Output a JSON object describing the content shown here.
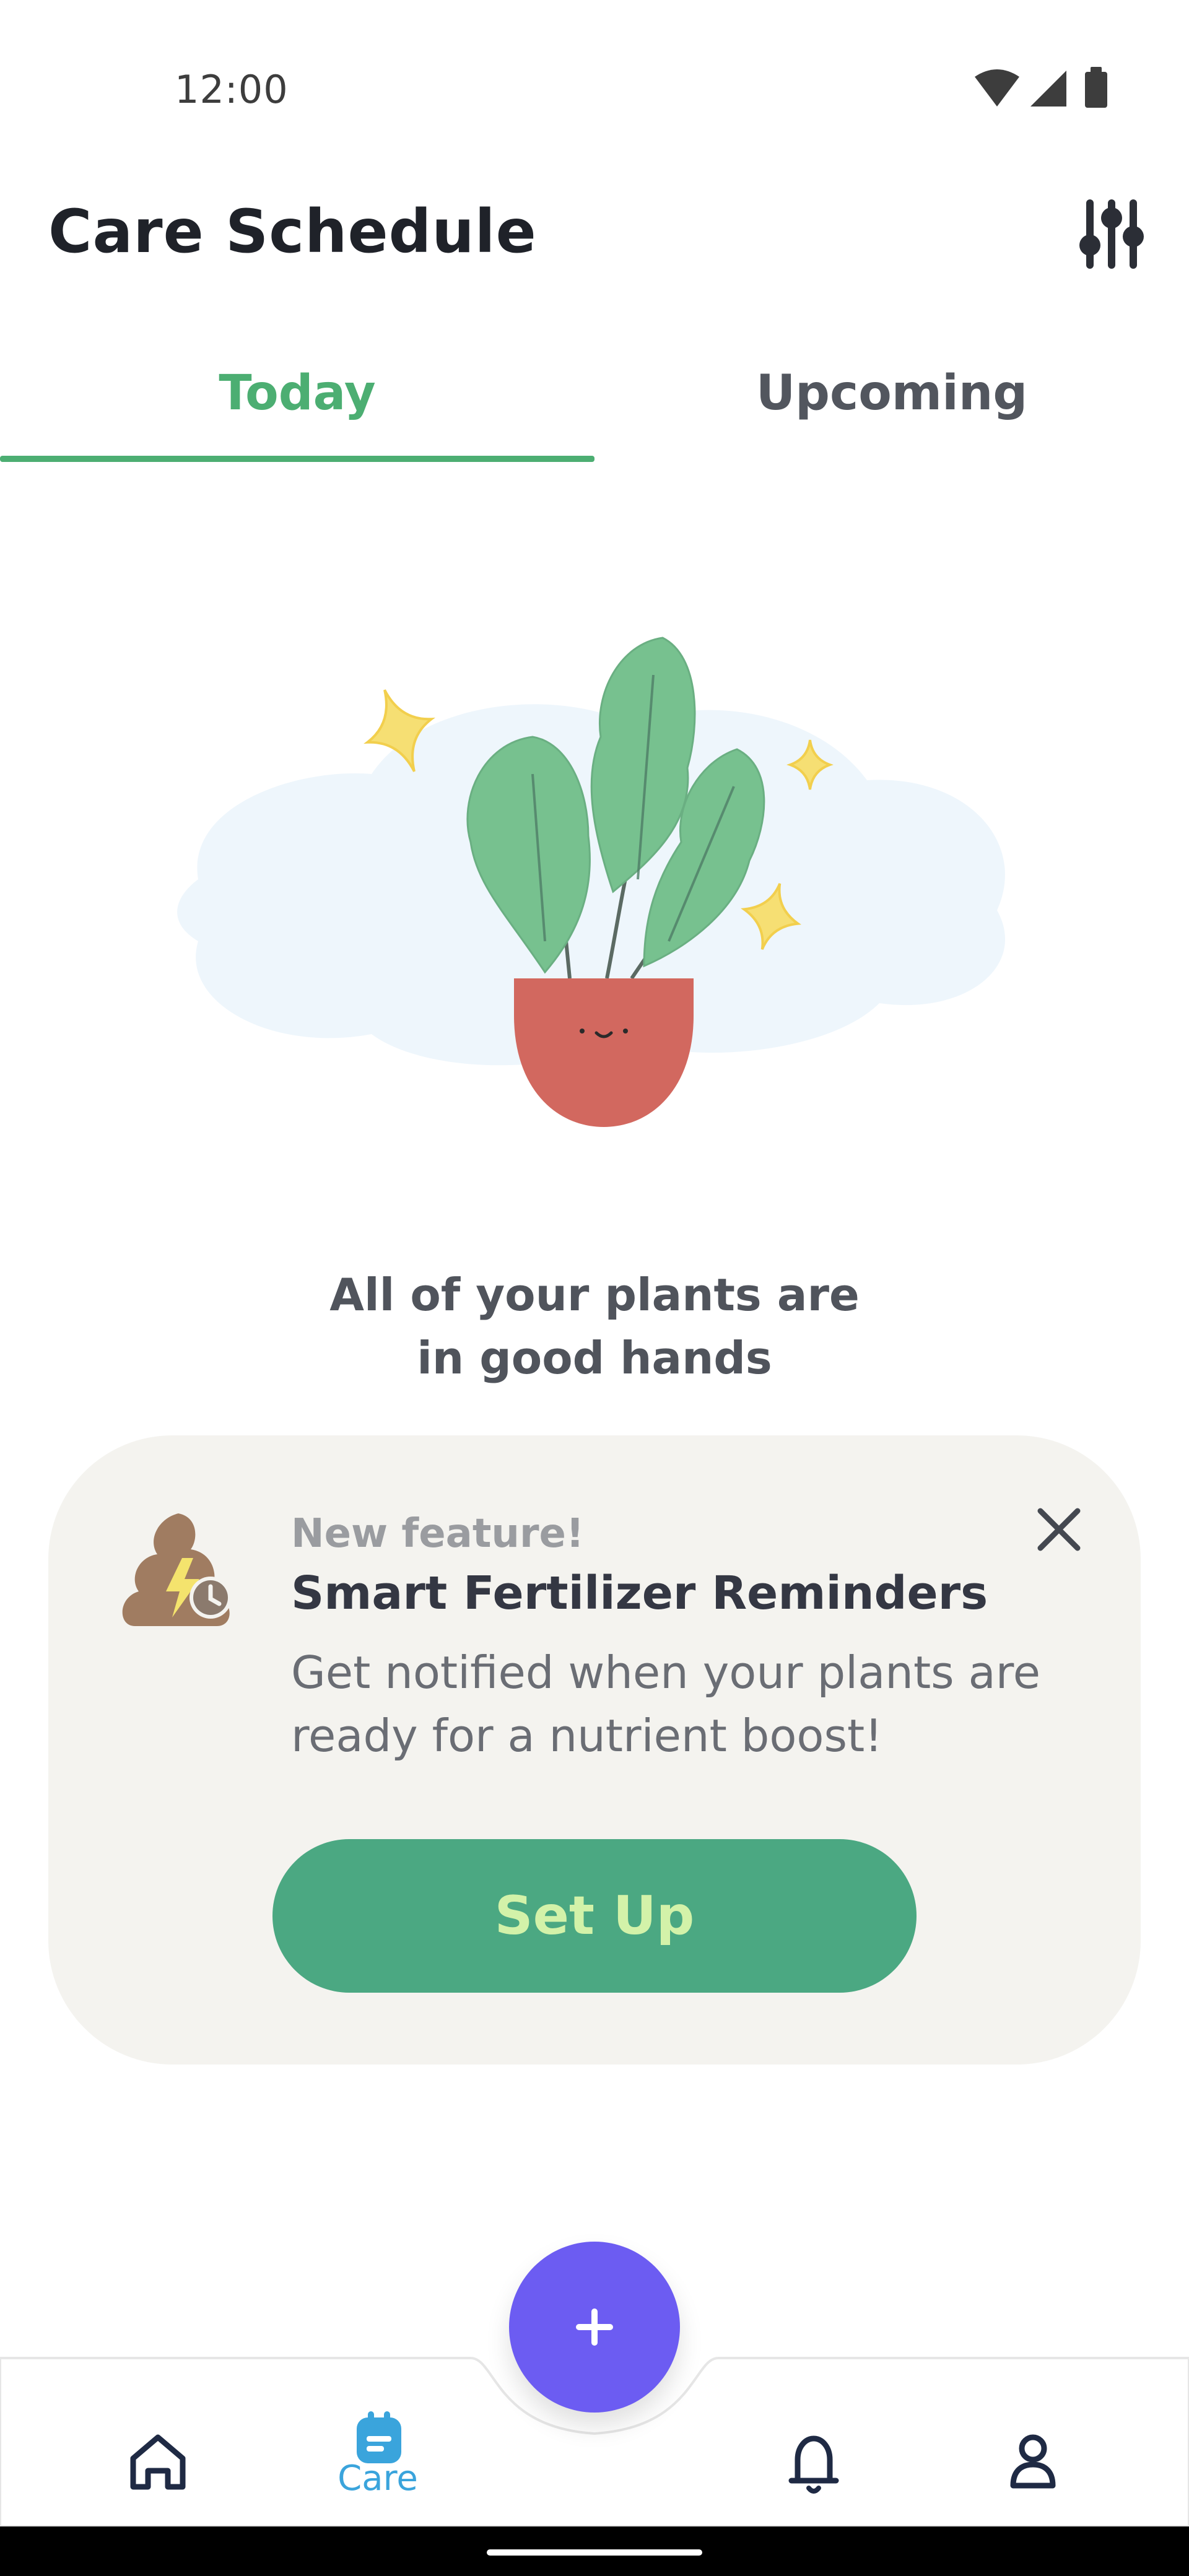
{
  "status_bar": {
    "time": "12:00",
    "icons": [
      "wifi-icon",
      "cell-signal-icon",
      "battery-icon"
    ]
  },
  "header": {
    "title": "Care Schedule",
    "filter_icon": "sliders-icon"
  },
  "tabs": [
    {
      "label": "Today",
      "selected": true
    },
    {
      "label": "Upcoming",
      "selected": false
    }
  ],
  "empty_state": {
    "illustration": "happy-plant-illustration",
    "message_line1": "All of your plants are",
    "message_line2": "in good hands"
  },
  "feature_card": {
    "eyebrow": "New feature!",
    "title": "Smart Fertilizer Reminders",
    "description": "Get notified when your plants are ready for a nutrient boost!",
    "button_label": "Set Up",
    "icon": "fertilizer-reminder-icon",
    "close_icon": "close-icon"
  },
  "bottom_nav": {
    "items": [
      {
        "icon": "home-icon",
        "label": ""
      },
      {
        "icon": "care-icon",
        "label": "Care",
        "active": true
      },
      {
        "icon": "bell-icon",
        "label": ""
      },
      {
        "icon": "profile-icon",
        "label": ""
      }
    ],
    "fab_icon": "plus-icon"
  },
  "colors": {
    "accent_green": "#4cae72",
    "button_green": "#4ba882",
    "button_text": "#d3f2a9",
    "fab_purple": "#6c5cf2",
    "care_blue": "#3aa4dc",
    "card_bg": "#f4f3ef"
  }
}
